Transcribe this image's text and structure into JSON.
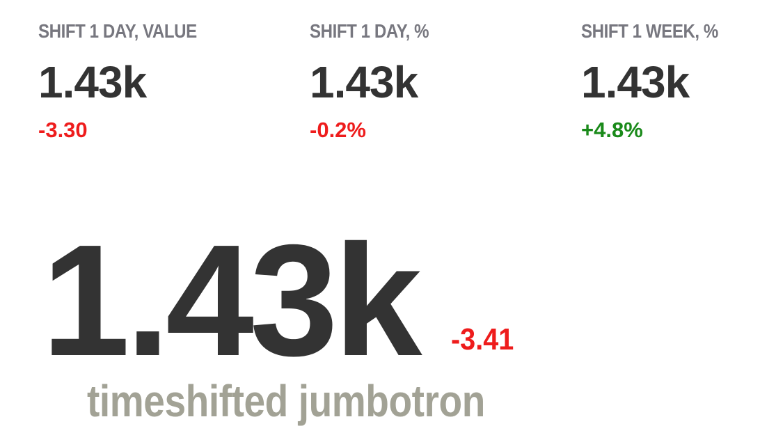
{
  "colors": {
    "negative": "#ee1c1c",
    "positive": "#1a8a1a",
    "title": "#77777f",
    "value": "#333333",
    "subtitle": "#a2a295"
  },
  "stats": [
    {
      "title": "SHIFT 1 DAY, VALUE",
      "value": "1.43k",
      "change": "-3.30",
      "trend": "negative"
    },
    {
      "title": "SHIFT 1 DAY, %",
      "value": "1.43k",
      "change": "-0.2%",
      "trend": "negative"
    },
    {
      "title": "SHIFT 1 WEEK, %",
      "value": "1.43k",
      "change": "+4.8%",
      "trend": "positive"
    }
  ],
  "jumbotron": {
    "value": "1.43k",
    "change": "-3.41",
    "trend": "negative",
    "label": "timeshifted jumbotron"
  }
}
